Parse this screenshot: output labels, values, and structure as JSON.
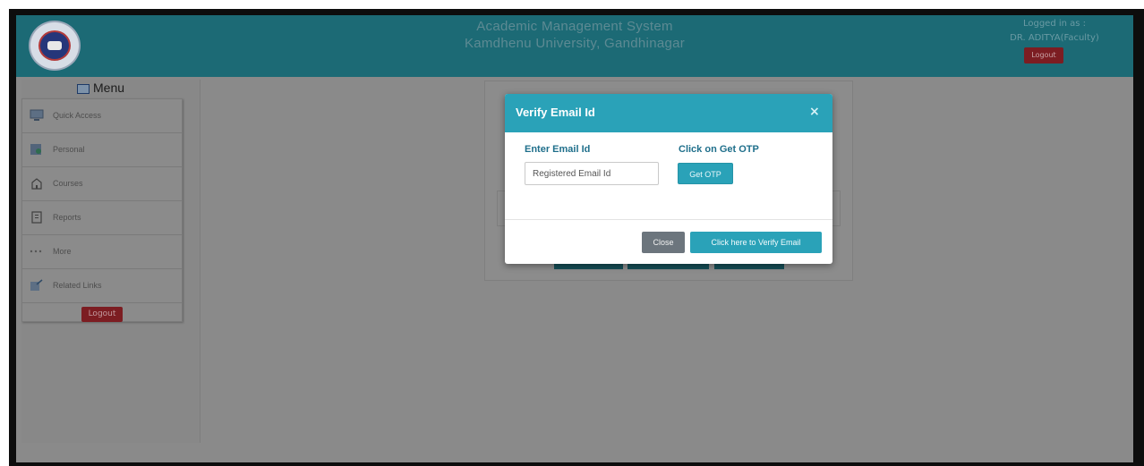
{
  "header": {
    "title_line1": "Academic Management System",
    "title_line2": "Kamdhenu University, Gandhinagar",
    "logged_label": "Logged in as :",
    "logged_user": "DR. ADITYA(Faculty)",
    "logout_label": "Logout"
  },
  "menu": {
    "title": "Menu",
    "items": [
      {
        "label": "Quick Access",
        "icon": "monitor-icon"
      },
      {
        "label": "Personal",
        "icon": "user-card-icon"
      },
      {
        "label": "Courses",
        "icon": "home-icon"
      },
      {
        "label": "Reports",
        "icon": "document-icon"
      },
      {
        "label": "More",
        "icon": "dots-icon"
      },
      {
        "label": "Related Links",
        "icon": "link-icon"
      }
    ],
    "logout_label": "Logout"
  },
  "modal": {
    "title": "Verify Email Id",
    "close_symbol": "×",
    "email_label": "Enter Email Id",
    "email_placeholder": "Registered Email Id",
    "email_value": "",
    "otp_label": "Click on Get OTP",
    "otp_button": "Get OTP",
    "close_button": "Close",
    "verify_button": "Click here to Verify Email"
  },
  "colors": {
    "header_bg": "#1c6a75",
    "modal_header_bg": "#2aa2b8",
    "logout_bg": "#7c1d22",
    "close_btn_bg": "#6c757d"
  }
}
